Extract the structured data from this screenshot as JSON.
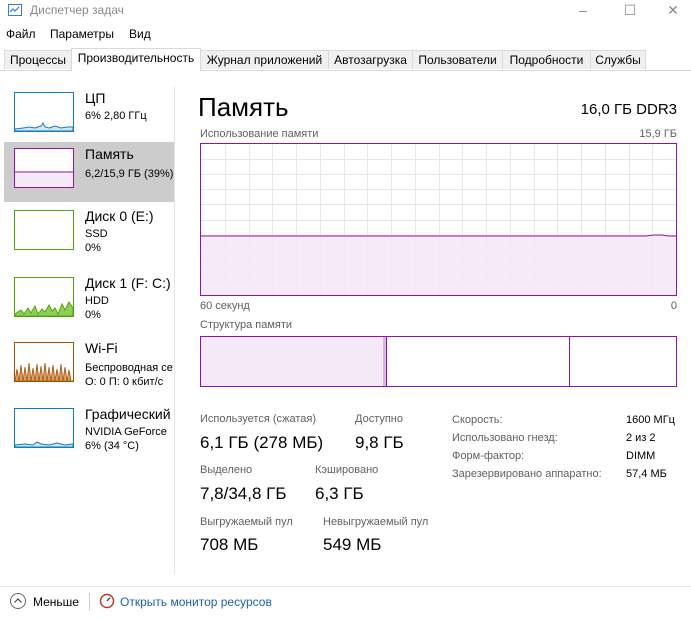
{
  "window": {
    "title": "Диспетчер задач",
    "minimize": "–",
    "maximize": "☐",
    "close": "✕"
  },
  "menu": [
    "Файл",
    "Параметры",
    "Вид"
  ],
  "tabs": [
    "Процессы",
    "Производительность",
    "Журнал приложений",
    "Автозагрузка",
    "Пользователи",
    "Подробности",
    "Службы"
  ],
  "active_tab": "Производительность",
  "sidebar": [
    {
      "title": "ЦП",
      "line1": "6% 2,80 ГГц",
      "line2": "",
      "color": "#117dbb"
    },
    {
      "title": "Память",
      "line1": "6,2/15,9 ГБ (39%)",
      "line2": "",
      "color": "#8b12ae"
    },
    {
      "title": "Диск 0 (E:)",
      "line1": "SSD",
      "line2": "0%",
      "color": "#4da60c"
    },
    {
      "title": "Диск 1 (F: C:)",
      "line1": "HDD",
      "line2": "0%",
      "color": "#4da60c"
    },
    {
      "title": "Wi-Fi",
      "line1": "Беспроводная сеть",
      "line2": "О: 0 П: 0 кбит/с",
      "color": "#a74f01"
    },
    {
      "title": "Графический процессор",
      "line1": "NVIDIA GeForce",
      "line2": "6% (34 °C)",
      "color": "#117dbb"
    }
  ],
  "main": {
    "title": "Память",
    "spec": "16,0 ГБ DDR3",
    "usage_label": "Использование памяти",
    "usage_max": "15,9 ГБ",
    "time_label": "60 секунд",
    "time_end": "0",
    "composition_label": "Структура памяти",
    "graph_fill_fraction": 0.39
  },
  "stats": {
    "in_use_label": "Используется (сжатая)",
    "in_use_value": "6,1 ГБ (278 МБ)",
    "available_label": "Доступно",
    "available_value": "9,8 ГБ",
    "committed_label": "Выделено",
    "committed_value": "7,8/34,8 ГБ",
    "cached_label": "Кэшировано",
    "cached_value": "6,3 ГБ",
    "paged_label": "Выгружаемый пул",
    "paged_value": "708 МБ",
    "nonpaged_label": "Невыгружаемый пул",
    "nonpaged_value": "549 МБ"
  },
  "specs": [
    {
      "label": "Скорость:",
      "value": "1600 МГц"
    },
    {
      "label": "Использовано гнезд:",
      "value": "2 из 2"
    },
    {
      "label": "Форм-фактор:",
      "value": "DIMM"
    },
    {
      "label": "Зарезервировано аппаратно:",
      "value": "57,4 МБ"
    }
  ],
  "footer": {
    "fewer": "Меньше",
    "resmon": "Открыть монитор ресурсов"
  }
}
